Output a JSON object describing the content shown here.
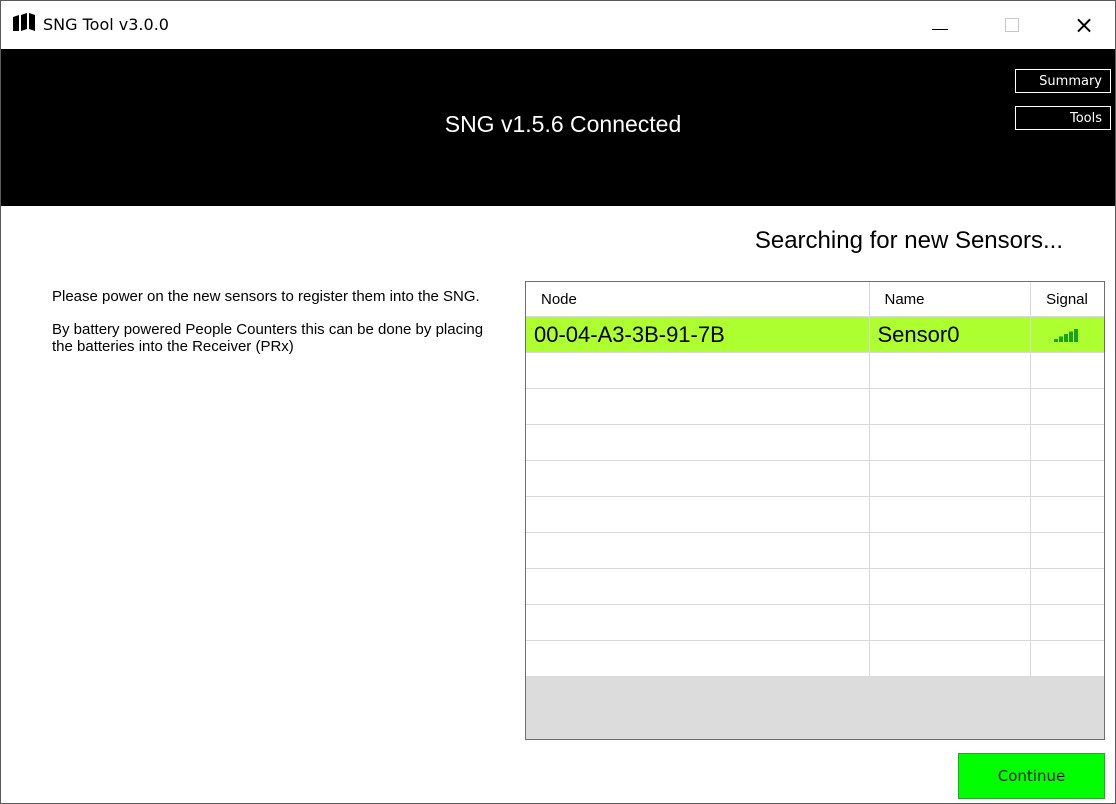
{
  "window": {
    "title": "SNG Tool v3.0.0",
    "close_glyph": "×"
  },
  "header": {
    "title": "SNG v1.5.6 Connected",
    "summary_label": "Summary",
    "tools_label": "Tools"
  },
  "status": {
    "searching_text": "Searching for new Sensors..."
  },
  "instructions": {
    "line1": "Please power on the new sensors to register them into the SNG.",
    "line2": "By battery powered People Counters this can be done by placing the batteries into the Receiver (PRx)"
  },
  "grid": {
    "columns": [
      "Node",
      "Name",
      "Signal"
    ],
    "rows": [
      {
        "node": "00-04-A3-3B-91-7B",
        "name": "Sensor0",
        "signal": "signal-bars-icon",
        "signal_level": 5,
        "signal_max": 5,
        "selected": true
      }
    ],
    "empty_rows": 9
  },
  "actions": {
    "continue_label": "Continue"
  },
  "colors": {
    "header_bg": "#000000",
    "selected_row": "#adff2f",
    "continue_bg": "#00ff00",
    "signal_bars": "#1aa31a"
  }
}
